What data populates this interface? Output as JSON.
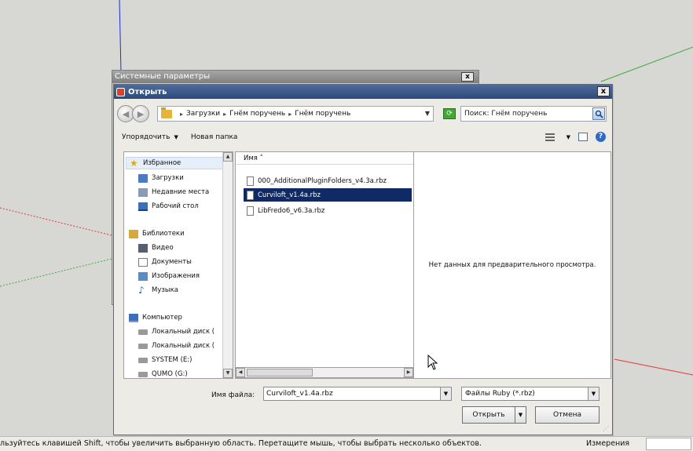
{
  "background_window": {
    "title": "Системные параметры",
    "close_label": "x"
  },
  "dialog": {
    "title": "Открыть",
    "close_label": "x",
    "breadcrumb": [
      "Загрузки",
      "Гнём поручень",
      "Гнём поручень"
    ],
    "search_placeholder": "Поиск: Гнём поручень",
    "toolbar": {
      "organize": "Упорядочить",
      "new_folder": "Новая папка"
    },
    "nav_pane": {
      "favorites": "Избранное",
      "favorites_items": [
        "Загрузки",
        "Недавние места",
        "Рабочий стол"
      ],
      "libraries": "Библиотеки",
      "libraries_items": [
        "Видео",
        "Документы",
        "Изображения",
        "Музыка"
      ],
      "computer": "Компьютер",
      "computer_items": [
        "Локальный диск (",
        "Локальный диск (",
        "SYSTEM (E:)",
        "QUMO (G:)"
      ]
    },
    "file_list": {
      "column_name": "Имя",
      "files": [
        "000_AdditionalPluginFolders_v4.3a.rbz",
        "Curviloft_v1.4a.rbz",
        "LibFredo6_v6.3a.rbz"
      ],
      "selected_index": 1
    },
    "preview_text": "Нет данных для предварительного просмотра.",
    "filename_label": "Имя файла:",
    "filename_value": "Curviloft_v1.4a.rbz",
    "filetype_value": "Файлы Ruby (*.rbz)",
    "open_button": "Открыть",
    "cancel_button": "Отмена"
  },
  "statusbar": {
    "text": "льзуйтесь клавишей Shift, чтобы увеличить выбранную область. Перетащите мышь, чтобы выбрать несколько объектов.",
    "measure_label": "Измерения"
  },
  "colors": {
    "selection": "#0f2a64",
    "titlebar": "#2b4a7d",
    "axis_blue": "#1c2bd8",
    "axis_red": "#e03a3a",
    "axis_green": "#3faa3f"
  },
  "icons": [
    "back-icon",
    "forward-icon",
    "folder-icon",
    "refresh-icon",
    "search-icon",
    "view-icon",
    "preview-pane-icon",
    "help-icon",
    "star-icon",
    "file-icon",
    "cursor-icon"
  ]
}
